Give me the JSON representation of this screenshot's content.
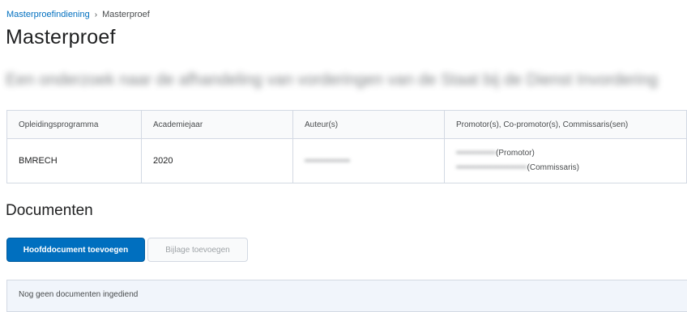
{
  "breadcrumb": {
    "parent": "Masterproefindiening",
    "separator": "›",
    "current": "Masterproef"
  },
  "page_title": "Masterproef",
  "thesis_title": "Een onderzoek naar de afhandeling van vorderingen van de Staat bij de Dienst Invordering",
  "table": {
    "headers": [
      "Opleidingsprogramma",
      "Academiejaar",
      "Auteur(s)",
      "Promotor(s), Co-promotor(s), Commissaris(sen)"
    ],
    "row": {
      "program": "BMRECH",
      "year": "2020",
      "author": "••••••••••••••••",
      "promotor_name": "••••••••••••••",
      "promotor_role": "(Promotor)",
      "commissaris_name": "•••••••••••••••••••••••••",
      "commissaris_role": "(Commissaris)"
    }
  },
  "documents": {
    "title": "Documenten",
    "add_main_label": "Hoofddocument toevoegen",
    "add_attachment_label": "Bijlage toevoegen",
    "empty_text": "Nog geen documenten ingediend"
  },
  "colors": {
    "primary": "#006fbf",
    "link": "#006fbf",
    "border": "#d3d9e3"
  }
}
